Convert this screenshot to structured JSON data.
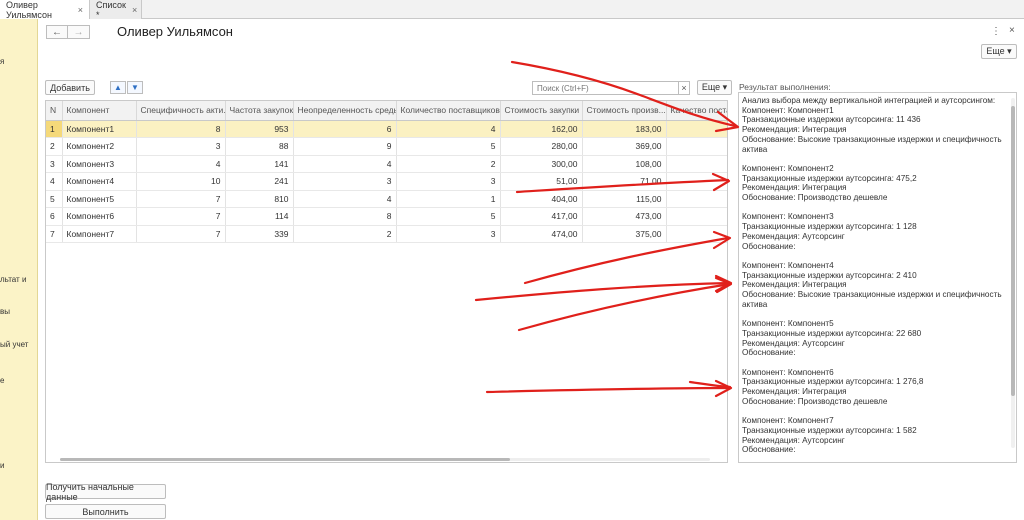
{
  "tabs": [
    {
      "label": "Оливер Уильямсон",
      "close": "×"
    },
    {
      "label": "Список *",
      "close": "×"
    }
  ],
  "left_pane": [
    "я",
    "льтат и",
    "вы",
    "ый учет",
    "е",
    "",
    "и"
  ],
  "window": {
    "title": "Оливер Уильямсон",
    "back": "←",
    "forward": "→",
    "kebab": "⋮",
    "close": "×",
    "more_label": "Еще ▾"
  },
  "toolbar": {
    "add_label": "Добавить",
    "up": "▲",
    "down": "▼",
    "search_placeholder": "Поиск (Ctrl+F)",
    "search_clear": "×",
    "more_label": "Еще ▾"
  },
  "table": {
    "columns": [
      "N",
      "Компонент",
      "Специфичность акти...",
      "Частота закупок",
      "Неопределенность среды",
      "Количество поставщиков",
      "Стоимость закупки",
      "Стоимость произв...",
      "Качество постав"
    ],
    "rows": [
      [
        "1",
        "Компонент1",
        "8",
        "953",
        "6",
        "4",
        "162,00",
        "183,00",
        ""
      ],
      [
        "2",
        "Компонент2",
        "3",
        "88",
        "9",
        "5",
        "280,00",
        "369,00",
        ""
      ],
      [
        "3",
        "Компонент3",
        "4",
        "141",
        "4",
        "2",
        "300,00",
        "108,00",
        ""
      ],
      [
        "4",
        "Компонент4",
        "10",
        "241",
        "3",
        "3",
        "51,00",
        "71,00",
        ""
      ],
      [
        "5",
        "Компонент5",
        "7",
        "810",
        "4",
        "1",
        "404,00",
        "115,00",
        ""
      ],
      [
        "6",
        "Компонент6",
        "7",
        "114",
        "8",
        "5",
        "417,00",
        "473,00",
        ""
      ],
      [
        "7",
        "Компонент7",
        "7",
        "339",
        "2",
        "3",
        "474,00",
        "375,00",
        ""
      ]
    ]
  },
  "result": {
    "label": "Результат выполнения:",
    "lines": [
      "Анализ выбора между вертикальной интеграцией и аутсорсингом:",
      "Компонент: Компонент1",
      "Транзакционные издержки аутсорсинга: 11 436",
      "Рекомендация: Интеграция",
      "Обоснование: Высокие транзакционные издержки и специфичность актива",
      "",
      "Компонент: Компонент2",
      "Транзакционные издержки аутсорсинга: 475,2",
      "Рекомендация: Интеграция",
      "Обоснование: Производство дешевле",
      "",
      "Компонент: Компонент3",
      "Транзакционные издержки аутсорсинга: 1 128",
      "Рекомендация: Аутсорсинг",
      "Обоснование:",
      "",
      "Компонент: Компонент4",
      "Транзакционные издержки аутсорсинга: 2 410",
      "Рекомендация: Интеграция",
      "Обоснование: Высокие транзакционные издержки и специфичность актива",
      "",
      "Компонент: Компонент5",
      "Транзакционные издержки аутсорсинга: 22 680",
      "Рекомендация: Аутсорсинг",
      "Обоснование:",
      "",
      "Компонент: Компонент6",
      "Транзакционные издержки аутсорсинга: 1 276,8",
      "Рекомендация: Интеграция",
      "Обоснование: Производство дешевле",
      "",
      "Компонент: Компонент7",
      "Транзакционные издержки аутсорсинга: 1 582",
      "Рекомендация: Аутсорсинг",
      "Обоснование:"
    ]
  },
  "bottom": {
    "get_data_label": "Получить начальные данные",
    "execute_label": "Выполнить"
  },
  "annotation_color": "#e0201b"
}
